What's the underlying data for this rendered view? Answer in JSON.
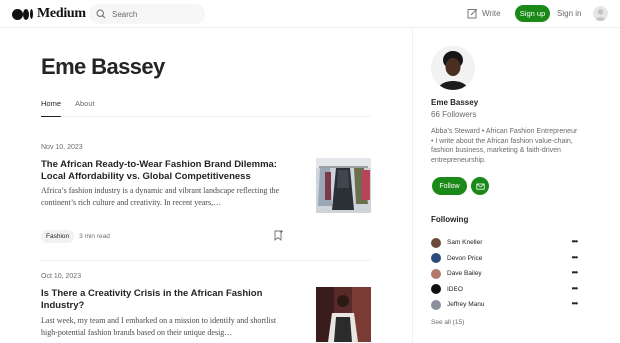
{
  "nav": {
    "logo_text": "Medium",
    "search_placeholder": "Search",
    "write_label": "Write",
    "signup_label": "Sign up",
    "signin_label": "Sign in"
  },
  "profile": {
    "name": "Eme Bassey",
    "tabs": [
      {
        "label": "Home"
      },
      {
        "label": "About"
      }
    ]
  },
  "articles": [
    {
      "date": "Nov 10, 2023",
      "title": "The African Ready-to-Wear Fashion Brand Dilemma: Local Affordability vs. Global Competitiveness",
      "excerpt": "Africa’s fashion industry is a dynamic and vibrant landscape reflecting the continent’s rich culture and creativity. In recent years,…",
      "tag": "Fashion",
      "read_time": "3 min read"
    },
    {
      "date": "Oct 10, 2023",
      "title": "Is There a Creativity Crisis in the African Fashion Industry?",
      "excerpt": "Last week, my team and I embarked on a mission to identify and shortlist high-potential fashion brands based on their unique desig…"
    }
  ],
  "sidebar": {
    "name": "Eme Bassey",
    "followers": "66 Followers",
    "bio": "Abba’s Steward • African Fashion Entrepreneur • I write about the African fashion value-chain, fashion business, marketing & faith-driven entrepreneurship.",
    "follow_label": "Follow",
    "following_title": "Following",
    "following": [
      {
        "name": "Sam Kneller",
        "color": "#6b4a3a"
      },
      {
        "name": "Devon Price",
        "color": "#2c4a7a"
      },
      {
        "name": "Dave Bailey",
        "color": "#b07a6a"
      },
      {
        "name": "IDEO",
        "color": "#111111"
      },
      {
        "name": "Jeffrey Manu",
        "color": "#8a8f9a"
      }
    ],
    "see_all": "See all (15)"
  },
  "colors": {
    "brand_green": "#1a8917",
    "text_primary": "#242424",
    "text_secondary": "#6b6b6b"
  }
}
